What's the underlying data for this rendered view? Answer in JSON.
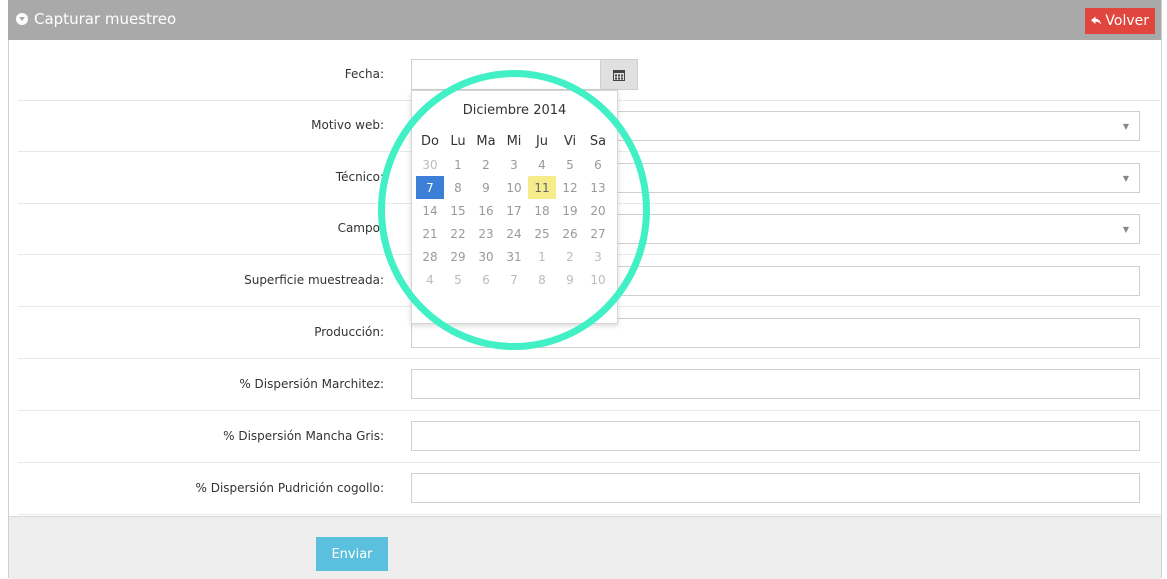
{
  "header": {
    "title": "Capturar muestreo",
    "back_label": "Volver"
  },
  "colors": {
    "header_bg": "#a9a9a9",
    "back_button": "#e0463d",
    "send_button": "#5bc0de",
    "selected_day": "#3b7fd6",
    "today_day": "#f7ec8b",
    "highlight_ring": "#41f0c4"
  },
  "form": {
    "fecha_label": "Fecha:",
    "motivo_label": "Motivo web:",
    "tecnico_label": "Técnico:",
    "campo_label": "Campo:",
    "superficie_label": "Superficie muestreada:",
    "produccion_label": "Producción:",
    "marchitez_label": "% Dispersión Marchitez:",
    "mancha_label": "% Dispersión Mancha Gris:",
    "pudricion_label": "% Dispersión Pudrición cogollo:"
  },
  "submit_label": "Enviar",
  "datepicker": {
    "month_title": "Diciembre 2014",
    "weekdays": [
      "Do",
      "Lu",
      "Ma",
      "Mi",
      "Ju",
      "Vi",
      "Sa"
    ],
    "weeks": [
      [
        "30",
        "1",
        "2",
        "3",
        "4",
        "5",
        "6"
      ],
      [
        "7",
        "8",
        "9",
        "10",
        "11",
        "12",
        "13"
      ],
      [
        "14",
        "15",
        "16",
        "17",
        "18",
        "19",
        "20"
      ],
      [
        "21",
        "22",
        "23",
        "24",
        "25",
        "26",
        "27"
      ],
      [
        "28",
        "29",
        "30",
        "31",
        "1",
        "2",
        "3"
      ],
      [
        "4",
        "5",
        "6",
        "7",
        "8",
        "9",
        "10"
      ]
    ],
    "selected_day": "7",
    "today_day": "11"
  },
  "icons": {
    "calendar": "calendar-icon",
    "back": "reply-arrow-icon",
    "select": "caret-down-icon"
  }
}
